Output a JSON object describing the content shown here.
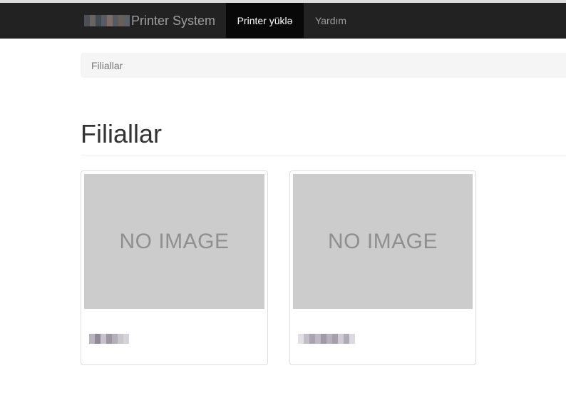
{
  "navbar": {
    "brand_text": "Printer System",
    "items": [
      {
        "label": "Printer yüklə",
        "active": true
      },
      {
        "label": "Yardım",
        "active": false
      }
    ]
  },
  "breadcrumb": {
    "current": "Filiallar"
  },
  "main": {
    "title": "Filiallar",
    "cards": [
      {
        "image_placeholder": "NO IMAGE",
        "caption": "",
        "caption_redacted": true
      },
      {
        "image_placeholder": "NO IMAGE",
        "caption": "",
        "caption_redacted": true
      }
    ]
  },
  "colors": {
    "navbar_bg": "#222222",
    "navbar_active_bg": "#080808",
    "navbar_text": "#9d9d9d",
    "placeholder_bg": "#cccccc",
    "placeholder_text": "#8f8f8f",
    "breadcrumb_bg": "#f5f5f5"
  }
}
